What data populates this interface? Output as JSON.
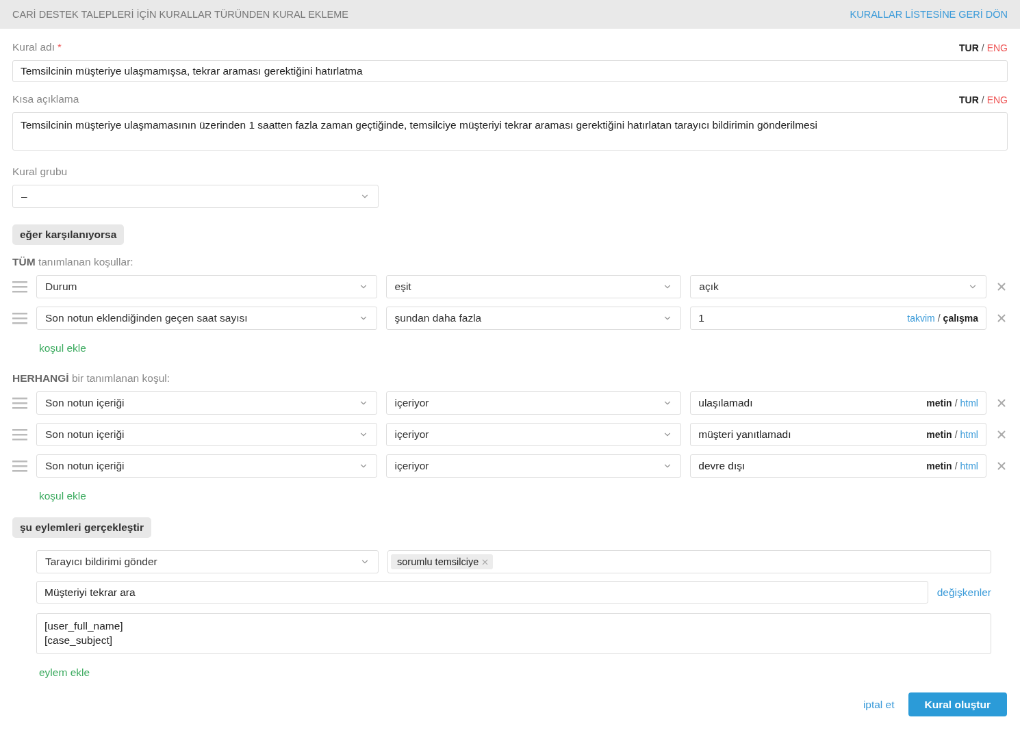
{
  "header": {
    "title": "CARİ DESTEK TALEPLERİ İÇİN KURALLAR TÜRÜNDEN KURAL EKLEME",
    "back_link": "KURALLAR LİSTESİNE GERİ DÖN"
  },
  "name_field": {
    "label": "Kural adı",
    "required_mark": "*",
    "value": "Temsilcinin müşteriye ulaşmamışsa, tekrar araması gerektiğini hatırlatma",
    "separator": "/",
    "languages": [
      {
        "label": "TUR",
        "selected": true
      },
      {
        "label": "ENG",
        "selected": false
      }
    ]
  },
  "description_field": {
    "label": "Kısa açıklama",
    "value": "Temsilcinin müşteriye ulaşmamasının üzerinden 1 saatten fazla zaman geçtiğinde, temsilciye müşteriyi tekrar araması gerektiğini hatırlatan tarayıcı bildirimin gönderilmesi",
    "separator": "/",
    "languages": [
      {
        "label": "TUR",
        "selected": true
      },
      {
        "label": "ENG",
        "selected": false
      }
    ]
  },
  "group_field": {
    "label": "Kural grubu",
    "value": "–"
  },
  "conditions_title": "eğer karşılanıyorsa",
  "condition_groups": [
    {
      "heading": "**TÜM** tanımlanan koşullar:",
      "add_label": "koşul ekle",
      "rows": [
        {
          "field": "Durum",
          "operator": "eşit",
          "kind": "select",
          "value": "açık"
        },
        {
          "field": "Son notun eklendiğinden geçen saat sayısı",
          "operator": "şundan daha fazla",
          "kind": "text",
          "value": "1",
          "separator": "/",
          "modes": [
            {
              "label": "takvim",
              "selected": false
            },
            {
              "label": "çalışma",
              "selected": true
            }
          ]
        }
      ]
    },
    {
      "heading": "**HERHANGİ** bir tanımlanan koşul:",
      "add_label": "koşul ekle",
      "rows": [
        {
          "field": "Son notun içeriği",
          "operator": "içeriyor",
          "kind": "text",
          "value": "ulaşılamadı",
          "separator": "/",
          "modes": [
            {
              "label": "metin",
              "selected": true
            },
            {
              "label": "html",
              "selected": false
            }
          ]
        },
        {
          "field": "Son notun içeriği",
          "operator": "içeriyor",
          "kind": "text",
          "value": "müşteri yanıtlamadı",
          "separator": "/",
          "modes": [
            {
              "label": "metin",
              "selected": true
            },
            {
              "label": "html",
              "selected": false
            }
          ]
        },
        {
          "field": "Son notun içeriği",
          "operator": "içeriyor",
          "kind": "text",
          "value": "devre dışı",
          "separator": "/",
          "modes": [
            {
              "label": "metin",
              "selected": true
            },
            {
              "label": "html",
              "selected": false
            }
          ]
        }
      ]
    }
  ],
  "actions_title": "şu eylemleri gerçekleştir",
  "actions": [
    {
      "type": "Tarayıcı bildirimi gönder",
      "recipients": [
        "sorumlu temsilciye"
      ],
      "subject": "Müşteriyi tekrar ara",
      "variables_link": "değişkenler",
      "body": "[user_full_name]\n[case_subject]"
    }
  ],
  "add_action": "eylem ekle",
  "footer": {
    "cancel": "iptal et",
    "submit": "Kural oluştur"
  }
}
